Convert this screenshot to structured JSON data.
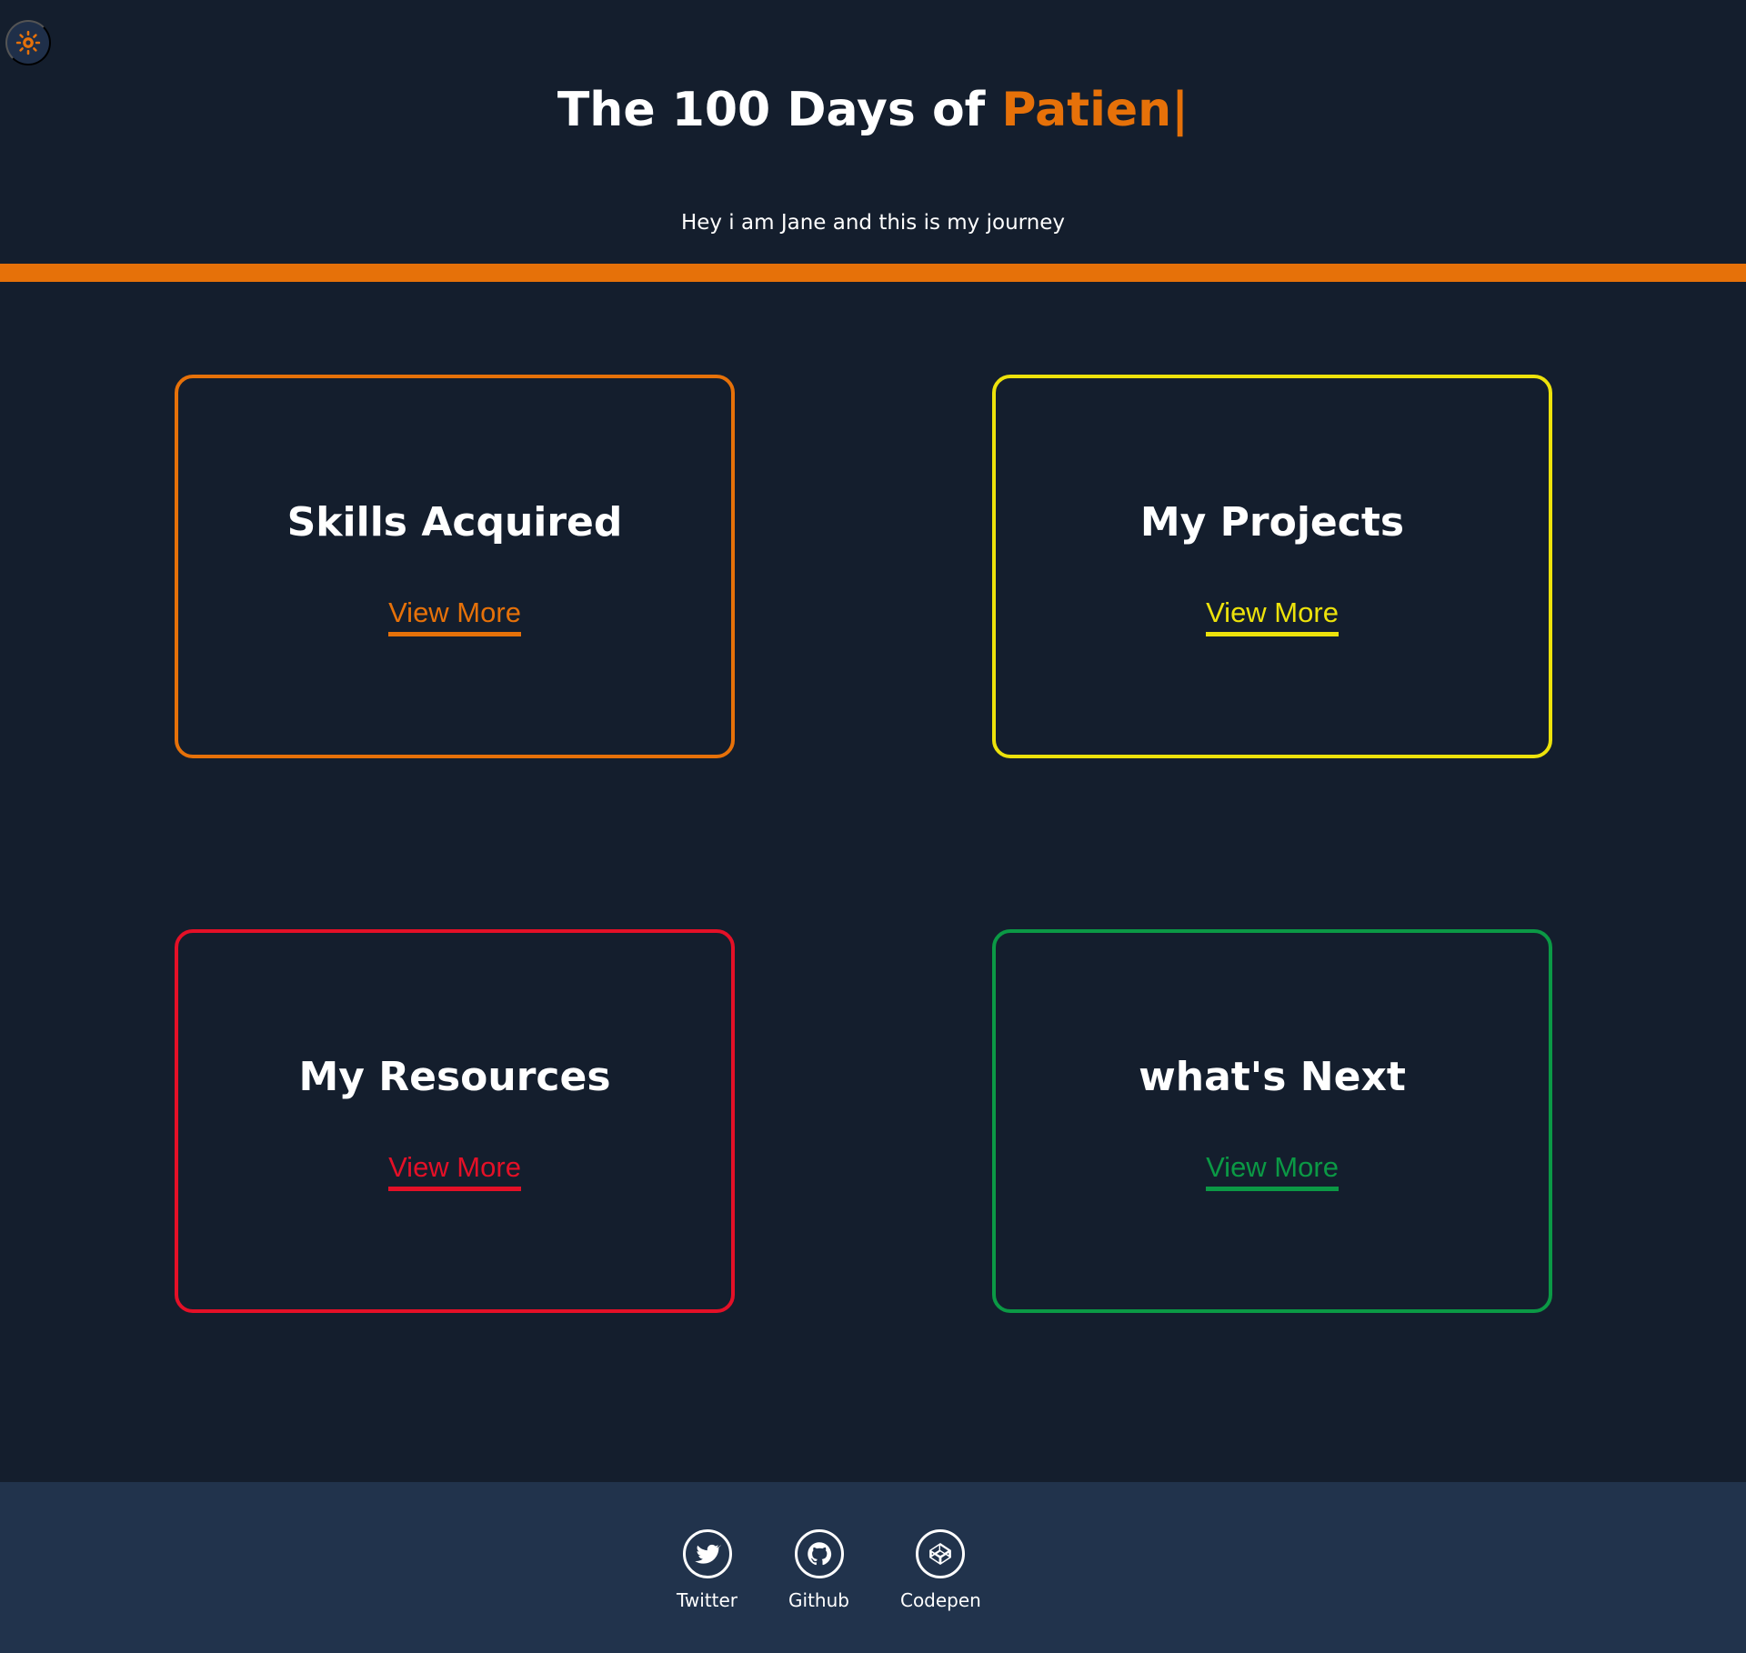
{
  "theme": {
    "toggle_icon": "sun-icon",
    "accent": "#e67109",
    "background": "#141e2d",
    "footer_background": "#21334c"
  },
  "hero": {
    "title_prefix": "The 100 Days of ",
    "title_highlight": "Patien|",
    "subtitle": "Hey i am Jane and this is my journey"
  },
  "cards": [
    {
      "title": "Skills Acquired",
      "link_label": "View More",
      "color": "#e67109"
    },
    {
      "title": "My Projects",
      "link_label": "View More",
      "color": "#ede20b"
    },
    {
      "title": "My Resources",
      "link_label": "View More",
      "color": "#e41027"
    },
    {
      "title": "what's Next",
      "link_label": "View More",
      "color": "#0b9945"
    }
  ],
  "footer": {
    "links": [
      {
        "label": "Twitter",
        "icon": "twitter-icon"
      },
      {
        "label": "Github",
        "icon": "github-icon"
      },
      {
        "label": "Codepen",
        "icon": "codepen-icon"
      }
    ]
  }
}
